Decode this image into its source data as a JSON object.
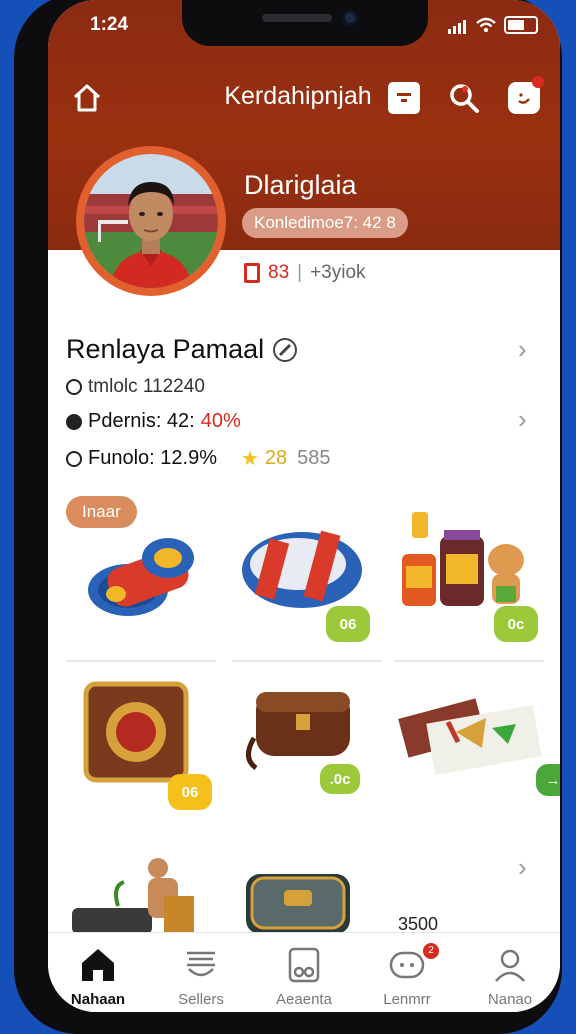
{
  "status_bar": {
    "time": "1:24"
  },
  "header": {
    "title": "Kerdahipnjah"
  },
  "profile": {
    "name": "Dlariglaia",
    "pill_text": "Konledimoe7: 42 8",
    "stat_count": "83",
    "stat_separator": "|",
    "stat_extra": "+3yiok"
  },
  "info": {
    "title": "Renlaya Pamaal",
    "line1": "tmlolc 112240",
    "line2_label": "Pdernis: 42: ",
    "line2_value": "40%",
    "line3_label": "Funolo: 12.9%",
    "line3_stars": "28",
    "line3_value": "585"
  },
  "section_tag": "Inaar",
  "items": [
    {
      "badge": "06"
    },
    {
      "badge": "0c"
    },
    {
      "badge": "06"
    },
    {
      "badge": ".0c"
    },
    {
      "badge": "→"
    }
  ],
  "price": "3500",
  "tabs": [
    {
      "label": "Nahaan"
    },
    {
      "label": "Sellers"
    },
    {
      "label": "Aeaenta"
    },
    {
      "label": "Lenmrr",
      "badge": "2"
    },
    {
      "label": "Nanao"
    }
  ],
  "colors": {
    "header": "#8b2b12",
    "accent": "#e2602d",
    "badge_green": "#9cc93a",
    "badge_yellow": "#f4c01a",
    "tag": "#d98c5e",
    "background": "#1550b8"
  }
}
